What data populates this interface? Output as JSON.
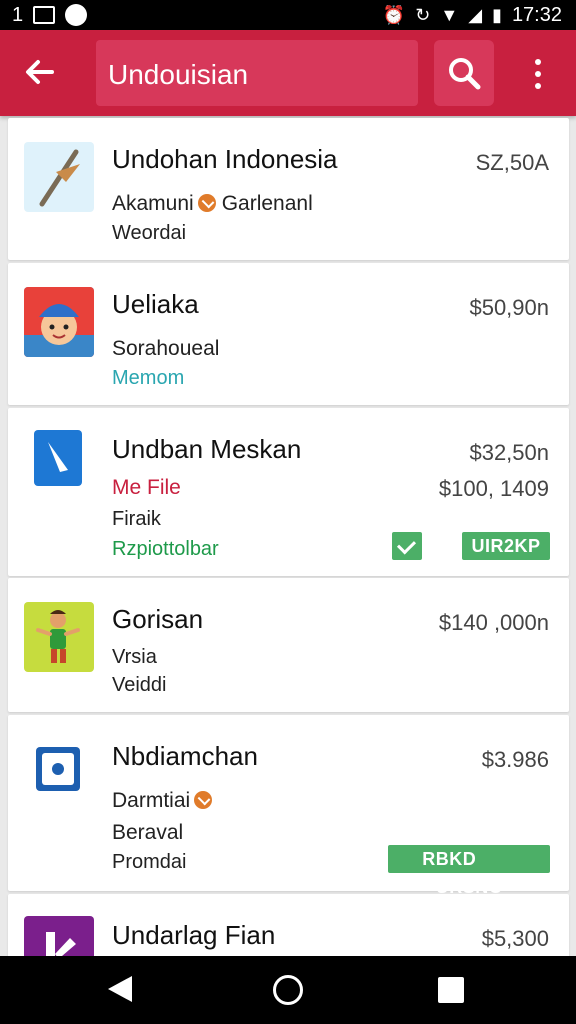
{
  "status_bar": {
    "left_number": "1",
    "time": "17:32"
  },
  "app_bar": {
    "search_value": "Undouisian"
  },
  "items": [
    {
      "title": "Undohan Indonesia",
      "price": "SZ,50A",
      "line1_a": "Akamuni",
      "line1_b": "Garlenanl",
      "line2": "Weordai"
    },
    {
      "title": "Ueliaka",
      "price": "$50,90n",
      "line1": "Sorahoueal",
      "line2": "Memom"
    },
    {
      "title": "Undban Meskan",
      "price": "$32,50n",
      "line1": "Me File",
      "price2": "$100, 1409",
      "line2": "Firaik",
      "line3": "Rzpiottolbar",
      "badge": "UIR2KP"
    },
    {
      "title": "Gorisan",
      "price": "$140 ,000n",
      "line1": "Vrsia",
      "line2": "Veiddi"
    },
    {
      "title": "Nbdiamchan",
      "price": "$3.986",
      "line1": "Darmtiai",
      "line2": "Beraval",
      "line3": "Promdai",
      "badge_a": "RBKD",
      "badge_b": "URSNC"
    },
    {
      "title": "Undarlag Fian",
      "price": "$5,300"
    }
  ],
  "colors": {
    "app_bar": "#c8203f",
    "accent_green": "#4caf67",
    "teal_text": "#2aa6b0"
  }
}
